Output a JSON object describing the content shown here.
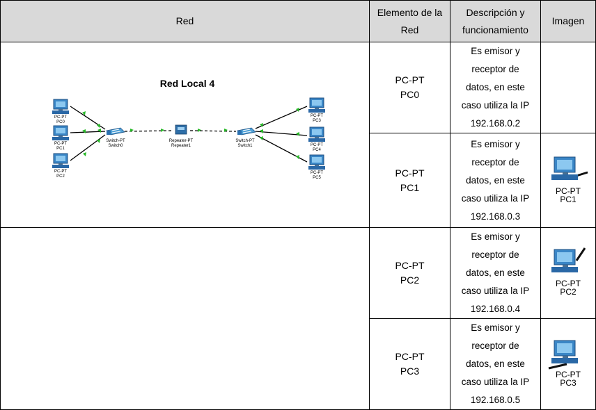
{
  "headers": {
    "red": "Red",
    "elemento": "Elemento de la Red",
    "descripcion": "Descripción y funcionamiento",
    "imagen": "Imagen"
  },
  "diagram": {
    "title": "Red Local 4",
    "devices": {
      "pc0": {
        "type": "PC-PT",
        "name": "PC0"
      },
      "pc1": {
        "type": "PC-PT",
        "name": "PC1"
      },
      "pc2": {
        "type": "PC-PT",
        "name": "PC2"
      },
      "pc3": {
        "type": "PC-PT",
        "name": "PC3"
      },
      "pc4": {
        "type": "PC-PT",
        "name": "PC4"
      },
      "pc5": {
        "type": "PC-PT",
        "name": "PC5"
      },
      "switch0": {
        "type": "Switch-PT",
        "name": "Switch0"
      },
      "switch1": {
        "type": "Switch-PT",
        "name": "Switch1"
      },
      "repeater1": {
        "type": "Repeater-PT",
        "name": "Repeater1"
      }
    }
  },
  "rows": [
    {
      "element_type": "PC-PT",
      "element_name": "PC0",
      "description": [
        "Es emisor y",
        "receptor de",
        "datos, en este",
        "caso utiliza la IP",
        "192.168.0.2"
      ],
      "image": null
    },
    {
      "element_type": "PC-PT",
      "element_name": "PC1",
      "description": [
        "Es emisor y",
        "receptor de",
        "datos, en este",
        "caso utiliza la IP",
        "192.168.0.3"
      ],
      "image": {
        "icon": "pc-icon",
        "label_type": "PC-PT",
        "label_name": "PC1"
      }
    },
    {
      "element_type": "PC-PT",
      "element_name": "PC2",
      "description": [
        "Es emisor y",
        "receptor de",
        "datos, en este",
        "caso utiliza la IP",
        "192.168.0.4"
      ],
      "image": {
        "icon": "pc-icon",
        "label_type": "PC-PT",
        "label_name": "PC2"
      }
    },
    {
      "element_type": "PC-PT",
      "element_name": "PC3",
      "description": [
        "Es emisor y",
        "receptor de",
        "datos, en este",
        "caso utiliza la IP",
        "192.168.0.5"
      ],
      "image": {
        "icon": "pc-icon",
        "label_type": "PC-PT",
        "label_name": "PC3"
      }
    }
  ],
  "colors": {
    "header_bg": "#d9d9d9",
    "link_up": "#27b827",
    "pc_screen": "#3a86c6",
    "pc_body": "#1f5f9a"
  }
}
